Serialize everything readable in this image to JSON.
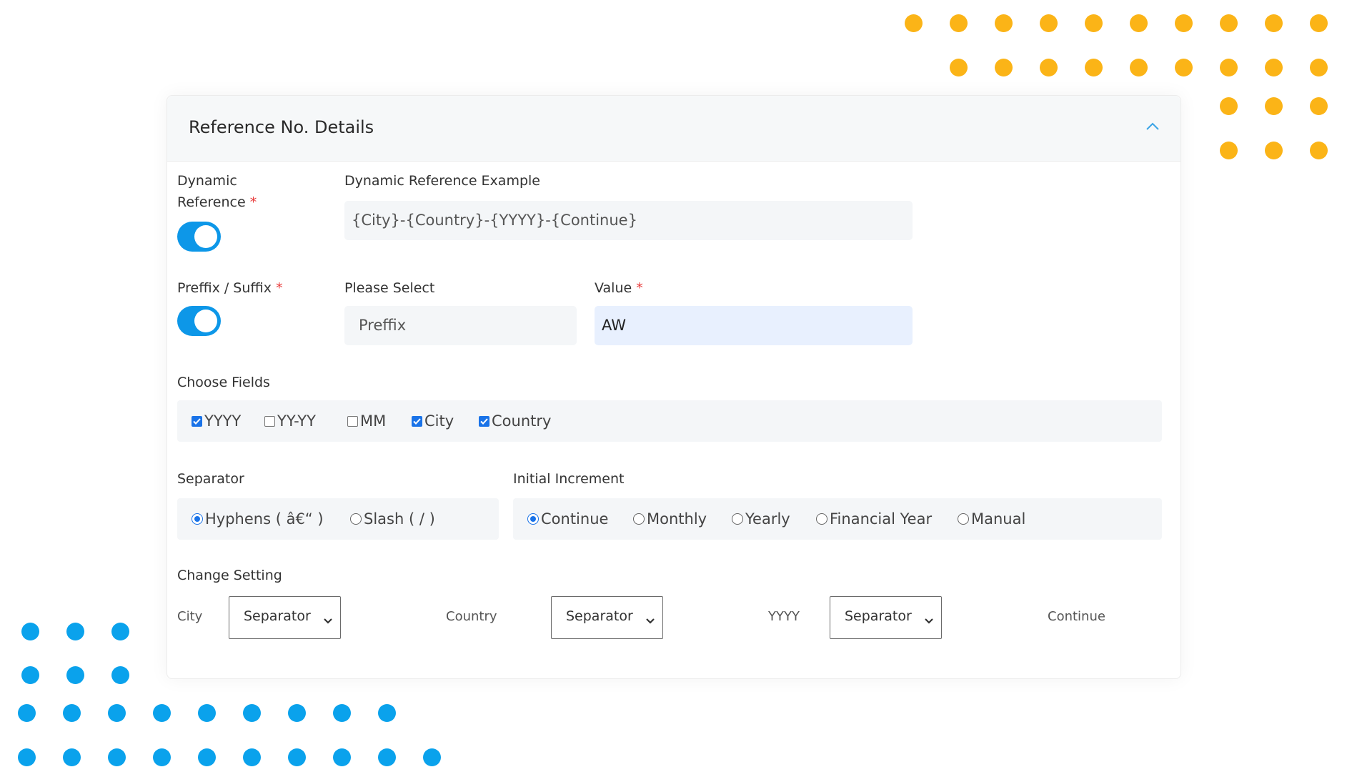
{
  "card": {
    "title": "Reference No. Details"
  },
  "dynamic_reference": {
    "label_line1": "Dynamic",
    "label_line2": "Reference",
    "required": "*",
    "enabled": true
  },
  "example": {
    "label": "Dynamic Reference Example",
    "value": "{City}-{Country}-{YYYY}-{Continue}"
  },
  "prefix_suffix": {
    "label": "Preffix / Suffix",
    "required": "*",
    "enabled": true
  },
  "please_select": {
    "label": "Please Select",
    "value": "Preffix"
  },
  "value_field": {
    "label": "Value",
    "required": "*",
    "value": "AW"
  },
  "choose_fields": {
    "label": "Choose Fields",
    "options": [
      {
        "label": "YYYY",
        "checked": true
      },
      {
        "label": "YY-YY",
        "checked": false
      },
      {
        "label": "MM",
        "checked": false
      },
      {
        "label": "City",
        "checked": true
      },
      {
        "label": "Country",
        "checked": true
      }
    ]
  },
  "separator": {
    "label": "Separator",
    "options": [
      {
        "label": "Hyphens ( â€“ )",
        "selected": true
      },
      {
        "label": "Slash ( / )",
        "selected": false
      }
    ]
  },
  "initial_increment": {
    "label": "Initial Increment",
    "options": [
      {
        "label": "Continue",
        "selected": true
      },
      {
        "label": "Monthly",
        "selected": false
      },
      {
        "label": "Yearly",
        "selected": false
      },
      {
        "label": "Financial Year",
        "selected": false
      },
      {
        "label": "Manual",
        "selected": false
      }
    ]
  },
  "change_setting": {
    "label": "Change Setting",
    "items": [
      {
        "field": "City",
        "separator": "Separator"
      },
      {
        "field": "Country",
        "separator": "Separator"
      },
      {
        "field": "YYYY",
        "separator": "Separator"
      },
      {
        "field": "Continue"
      }
    ]
  },
  "colors": {
    "accent": "#0d97e8",
    "check": "#1a73e8",
    "orange_dots": "#fbb417",
    "blue_dots": "#0aa2ec"
  }
}
